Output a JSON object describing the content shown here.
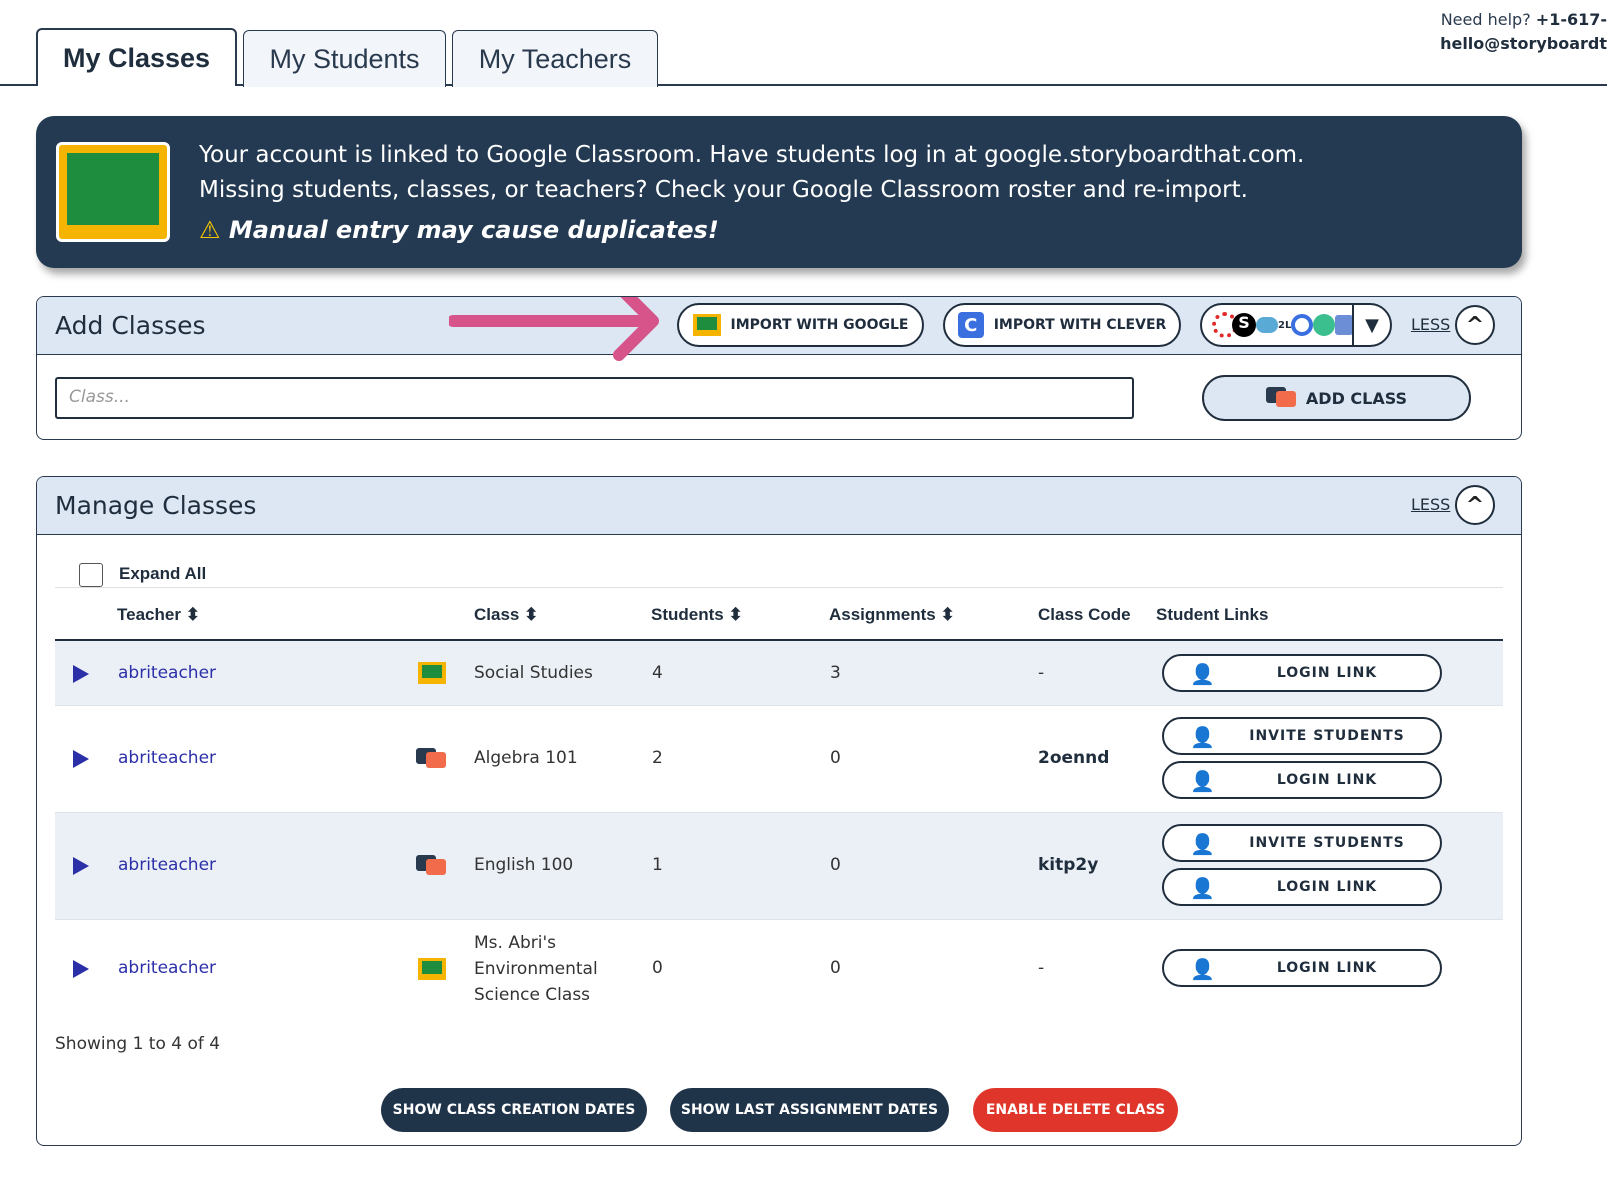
{
  "tabs": [
    {
      "label": "My Classes"
    },
    {
      "label": "My Students"
    },
    {
      "label": "My Teachers"
    }
  ],
  "help": {
    "prefix": "Need help?",
    "phone": "+1-617-",
    "email": "hello@storyboardt"
  },
  "banner": {
    "line1": "Your account is linked to Google Classroom. Have students log in at google.storyboardthat.com.",
    "line2": "Missing students, classes, or teachers? Check your Google Classroom roster and re-import.",
    "warning": "Manual entry may cause duplicates!"
  },
  "add_classes": {
    "title": "Add Classes",
    "import_google": "IMPORT WITH GOOGLE",
    "import_clever": "IMPORT WITH CLEVER",
    "less": "LESS",
    "placeholder": "Class...",
    "add_class": "ADD CLASS"
  },
  "manage": {
    "title": "Manage Classes",
    "less": "LESS",
    "expand_all": "Expand All",
    "headers": {
      "teacher": "Teacher",
      "class": "Class",
      "students": "Students",
      "assignments": "Assignments",
      "code": "Class Code",
      "links": "Student Links"
    },
    "rows": [
      {
        "teacher": "abriteacher",
        "source": "google",
        "class": "Social Studies",
        "students": "4",
        "assignments": "3",
        "code": "-",
        "buttons": [
          "LOGIN LINK"
        ]
      },
      {
        "teacher": "abriteacher",
        "source": "manual",
        "class": "Algebra 101",
        "students": "2",
        "assignments": "0",
        "code": "2oennd",
        "buttons": [
          "INVITE STUDENTS",
          "LOGIN LINK"
        ]
      },
      {
        "teacher": "abriteacher",
        "source": "manual",
        "class": "English 100",
        "students": "1",
        "assignments": "0",
        "code": "kitp2y",
        "buttons": [
          "INVITE STUDENTS",
          "LOGIN LINK"
        ]
      },
      {
        "teacher": "abriteacher",
        "source": "google",
        "class": "Ms. Abri's Environmental Science Class",
        "students": "0",
        "assignments": "0",
        "code": "-",
        "buttons": [
          "LOGIN LINK"
        ]
      }
    ],
    "showing": "Showing 1 to 4 of 4",
    "show_creation": "SHOW CLASS CREATION DATES",
    "show_last": "SHOW LAST ASSIGNMENT DATES",
    "enable_delete": "ENABLE DELETE CLASS"
  },
  "colors": {
    "navy": "#243a52",
    "accent_arrow": "#d6548a",
    "delete": "#e0352b",
    "link": "#2b2fa8"
  }
}
